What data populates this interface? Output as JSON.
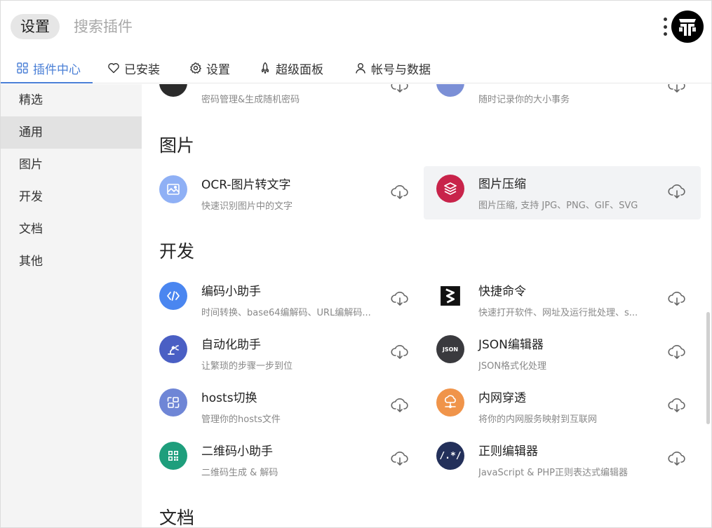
{
  "header": {
    "settings_label": "设置",
    "search_placeholder": "搜索插件"
  },
  "tabs": [
    {
      "label": "插件中心",
      "icon": "grid-icon",
      "active": true
    },
    {
      "label": "已安装",
      "icon": "heart-icon"
    },
    {
      "label": "设置",
      "icon": "gear-icon"
    },
    {
      "label": "超级面板",
      "icon": "rocket-icon"
    },
    {
      "label": "帐号与数据",
      "icon": "user-icon"
    }
  ],
  "sidebar": {
    "items": [
      {
        "label": "精选"
      },
      {
        "label": "通用",
        "active": true
      },
      {
        "label": "图片"
      },
      {
        "label": "开发"
      },
      {
        "label": "文档"
      },
      {
        "label": "其他"
      }
    ]
  },
  "sections": {
    "top_partial": [
      {
        "desc": "密码管理&生成随机密码",
        "icon_color": "#2b2b2b"
      },
      {
        "desc": "随时记录你的大小事务",
        "icon_color": "#7b8fd6"
      }
    ],
    "images": {
      "title": "图片",
      "plugins": [
        {
          "name": "OCR-图片转文字",
          "desc": "快速识别图片中的文字",
          "icon": "image-icon",
          "icon_color": "#8fb0f5"
        },
        {
          "name": "图片压缩",
          "desc": "图片压缩, 支持 JPG、PNG、GIF、SVG",
          "icon": "layers-icon",
          "icon_color": "#c8234a"
        }
      ]
    },
    "dev": {
      "title": "开发",
      "plugins": [
        {
          "name": "编码小助手",
          "desc": "时间转换、base64编解码、URL编解码...",
          "icon": "code-icon",
          "icon_color": "#4a86f0"
        },
        {
          "name": "快捷命令",
          "desc": "快速打开软件、网址及运行批处理、s...",
          "icon": "shortcut-icon",
          "icon_color": "#ffffff"
        },
        {
          "name": "自动化助手",
          "desc": "让繁琐的步骤一步到位",
          "icon": "robot-arm-icon",
          "icon_color": "#4a5fc4"
        },
        {
          "name": "JSON编辑器",
          "desc": "JSON格式化处理",
          "icon": "json-icon",
          "icon_color": "#3a3a3e",
          "icon_text": "JSON"
        },
        {
          "name": "hosts切换",
          "desc": "管理你的hosts文件",
          "icon": "swap-icon",
          "icon_color": "#6f86d6"
        },
        {
          "name": "内网穿透",
          "desc": "将你的内网服务映射到互联网",
          "icon": "network-icon",
          "icon_color": "#f0944a"
        },
        {
          "name": "二维码小助手",
          "desc": "二维码生成 & 解码",
          "icon": "qrcode-icon",
          "icon_color": "#1e9e7c"
        },
        {
          "name": "正则编辑器",
          "desc": "JavaScript & PHP正则表达式编辑器",
          "icon": "regex-icon",
          "icon_color": "#23305a",
          "icon_text": "/.*/"
        }
      ]
    },
    "docs": {
      "title": "文档"
    }
  }
}
